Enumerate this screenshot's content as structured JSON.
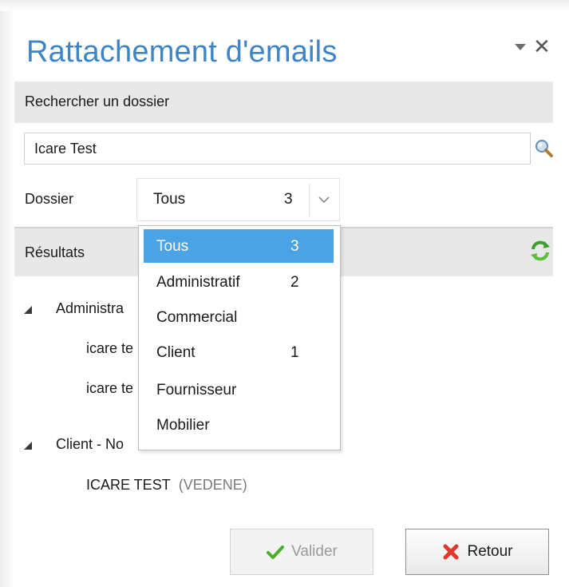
{
  "window": {
    "title": "Rattachement d'emails",
    "menu_icon": "dropdown-triangle-icon",
    "close_glyph": "✕"
  },
  "search": {
    "section_label": "Rechercher un dossier",
    "value": "Icare Test",
    "icon": "magnifier-icon"
  },
  "dossier": {
    "label": "Dossier",
    "selected_value": "Tous",
    "selected_count": "3",
    "options": [
      {
        "label": "Tous",
        "count": "3",
        "selected": true
      },
      {
        "label": "Administratif",
        "count": "2",
        "selected": false
      },
      {
        "label": "Commercial",
        "count": "",
        "selected": false
      },
      {
        "label": "Client",
        "count": "1",
        "selected": false
      },
      {
        "label": "Fournisseur",
        "count": "",
        "selected": false
      },
      {
        "label": "Mobilier",
        "count": "",
        "selected": false
      }
    ]
  },
  "results": {
    "section_label": "Résultats",
    "refresh_icon": "refresh-icon",
    "tree": {
      "group1": {
        "label": "Administra"
      },
      "group1_items": [
        "icare te",
        "icare te"
      ],
      "group2": {
        "label": "Client - No"
      },
      "group2_item": {
        "name": "ICARE TEST",
        "location": "(VEDENE)"
      }
    }
  },
  "buttons": {
    "validate": "Valider",
    "back": "Retour"
  },
  "colors": {
    "title": "#3e85c8",
    "selected_option": "#4aa3e4",
    "band": "#e8e8e8",
    "check_green": "#4caf2a",
    "cross_red": "#e0382b"
  }
}
